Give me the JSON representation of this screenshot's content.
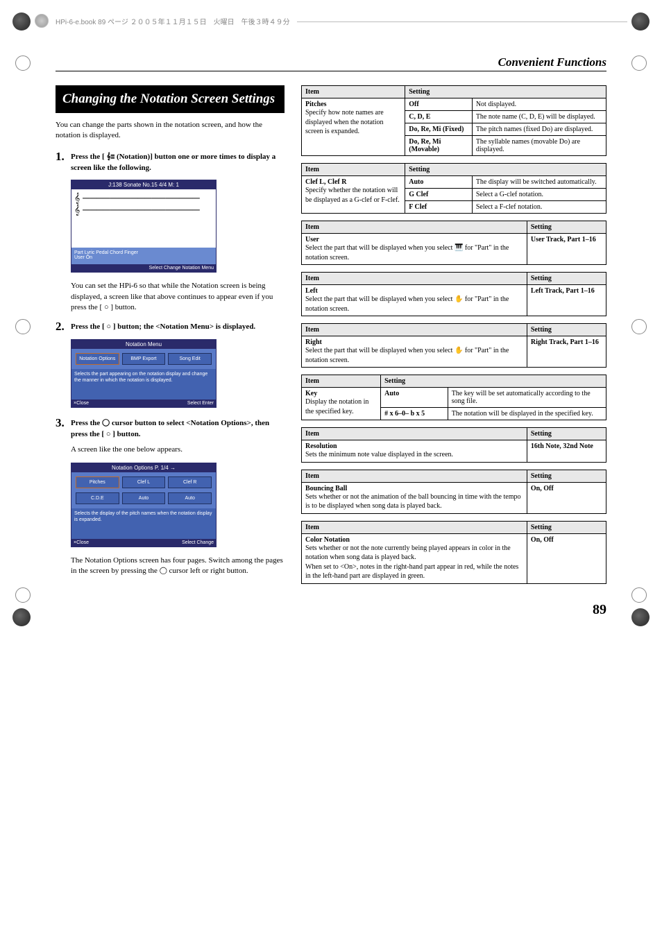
{
  "meta_header": "HPi-6-e.book 89 ページ ２００５年１１月１５日　火曜日　午後３時４９分",
  "page_header": "Convenient Functions",
  "section_title": "Changing the Notation Screen Settings",
  "intro": "You can change the parts shown in the notation screen, and how the notation is displayed.",
  "steps": {
    "s1_num": "1.",
    "s1_text_a": "Press the [ ",
    "s1_text_b": " (Notation)] button one or more times to display a screen like the following.",
    "s1_sub": "You can set the HPi-6 so that while the Notation screen is being displayed, a screen like that above continues to appear even if you press the [ ○ ] button.",
    "s2_num": "2.",
    "s2_text": "Press the [ ○ ] button; the <Notation Menu> is displayed.",
    "s3_num": "3.",
    "s3_text_a": "Press the ",
    "s3_text_b": " cursor button to select <Notation Options>, then press the [ ○ ] button.",
    "s3_sub1": "A screen like the one below appears.",
    "s3_sub2_a": "The Notation Options screen has four pages. Switch among the pages in the screen by pressing the ",
    "s3_sub2_b": " cursor left or right button."
  },
  "mock1": {
    "title": "J:138 Sonate No.15              4/4  M:   1",
    "tabs": "Part   Lyric   Pedal   Chord   Finger",
    "tabrow2": "           User                       On",
    "footer_l": "",
    "footer_r": "Select   Change   Notation Menu"
  },
  "mock2": {
    "title": "Notation Menu",
    "icon1": "Notation Options",
    "icon2": "BMP Export",
    "icon3": "Song Edit",
    "desc": "Selects the part appearing on the notation display and change the manner in which the notation is displayed.",
    "footer_l": "×Close",
    "footer_r": "Select   Enter"
  },
  "mock3": {
    "title": "Notation Options          P. 1/4 →",
    "cell11": "Pitches",
    "cell12": "Clef L",
    "cell13": "Clef R",
    "cell21": "C.D.E",
    "cell22": "Auto",
    "cell23": "Auto",
    "desc": "Selects the display of the pitch names when the notation display is expanded.",
    "footer_l": "×Close",
    "footer_r": "Select   Change"
  },
  "th_item": "Item",
  "th_setting": "Setting",
  "t1": {
    "item_name": "Pitches",
    "item_desc": "Specify how note names are displayed when the notation screen is expanded.",
    "r1s": "Off",
    "r1d": "Not displayed.",
    "r2s": "C, D, E",
    "r2d": "The note name (C, D, E) will be displayed.",
    "r3s": "Do, Re, Mi (Fixed)",
    "r3d": "The pitch names (fixed Do) are displayed.",
    "r4s": "Do, Re, Mi (Movable)",
    "r4d": "The syllable names (movable Do) are displayed."
  },
  "t2": {
    "item_name": "Clef L, Clef R",
    "item_desc": "Specify whether the notation will be displayed as a G-clef or F-clef.",
    "r1s": "Auto",
    "r1d": "The display will be switched automatically.",
    "r2s": "G Clef",
    "r2d": "Select a G-clef notation.",
    "r3s": "F Clef",
    "r3d": "Select a F-clef notation."
  },
  "t3": {
    "name": "User",
    "desc_a": "Select the part that will be displayed when you select ",
    "desc_b": " for \"Part\" in the notation screen.",
    "setting": "User Track, Part 1–16"
  },
  "t4": {
    "name": "Left",
    "desc_a": "Select the part that will be displayed when you select ",
    "desc_b": " for \"Part\" in the notation screen.",
    "setting": "Left Track, Part 1–16"
  },
  "t5": {
    "name": "Right",
    "desc_a": "Select the part that will be displayed when you select ",
    "desc_b": " for \"Part\" in the notation screen.",
    "setting": "Right Track, Part 1–16"
  },
  "t6": {
    "item_name": "Key",
    "item_desc": "Display the notation in the specified key.",
    "r1s": "Auto",
    "r1d": "The key will be set automatically according to the song file.",
    "r2s": "# x 6–0– b x 5",
    "r2d": "The notation will be displayed in the specified key."
  },
  "t7": {
    "name": "Resolution",
    "desc": "Sets the minimum note value displayed in the screen.",
    "setting": "16th Note, 32nd Note"
  },
  "t8": {
    "name": "Bouncing Ball",
    "desc": "Sets whether or not the animation of the ball bouncing in time with the tempo is to be displayed when song data is played back.",
    "setting": "On, Off"
  },
  "t9": {
    "name": "Color Notation",
    "desc": "Sets whether or not the note currently being played appears in color in the notation when song data is played back.\nWhen set to <On>, notes in the right-hand part appear in red, while the notes in the left-hand part are displayed in green.",
    "setting": "On, Off"
  },
  "page_num": "89"
}
